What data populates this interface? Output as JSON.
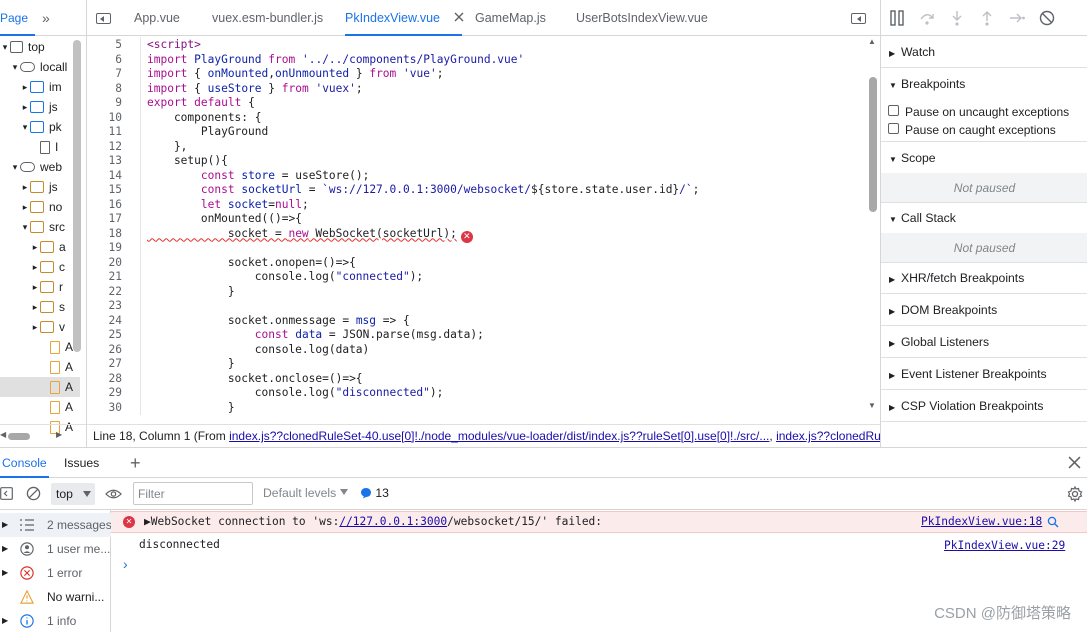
{
  "navigator": {
    "tab_page": "Page",
    "tab_more": "»",
    "items": [
      {
        "label": "top",
        "indent": 0,
        "arrow": "▾",
        "icon": "frame"
      },
      {
        "label": "locall",
        "indent": 1,
        "arrow": "▾",
        "icon": "cloud"
      },
      {
        "label": "im",
        "indent": 2,
        "arrow": "▸",
        "icon": "folder"
      },
      {
        "label": "js",
        "indent": 2,
        "arrow": "▸",
        "icon": "folder"
      },
      {
        "label": "pk",
        "indent": 2,
        "arrow": "▾",
        "icon": "folder"
      },
      {
        "label": "I",
        "indent": 3,
        "arrow": "",
        "icon": "file"
      },
      {
        "label": "web",
        "indent": 1,
        "arrow": "▾",
        "icon": "cloud"
      },
      {
        "label": "js",
        "indent": 2,
        "arrow": "▸",
        "icon": "folder-or"
      },
      {
        "label": "no",
        "indent": 2,
        "arrow": "▸",
        "icon": "folder-or"
      },
      {
        "label": "src",
        "indent": 2,
        "arrow": "▾",
        "icon": "folder-or"
      },
      {
        "label": "a",
        "indent": 3,
        "arrow": "▸",
        "icon": "folder-or"
      },
      {
        "label": "c",
        "indent": 3,
        "arrow": "▸",
        "icon": "folder-or"
      },
      {
        "label": "r",
        "indent": 3,
        "arrow": "▸",
        "icon": "folder-or"
      },
      {
        "label": "s",
        "indent": 3,
        "arrow": "▸",
        "icon": "folder-or"
      },
      {
        "label": "v",
        "indent": 3,
        "arrow": "▸",
        "icon": "folder-or"
      },
      {
        "label": "A",
        "indent": 4,
        "arrow": "",
        "icon": "file-or"
      },
      {
        "label": "A",
        "indent": 4,
        "arrow": "",
        "icon": "file-or"
      },
      {
        "label": "A",
        "indent": 4,
        "arrow": "",
        "icon": "file-or",
        "selected": true
      },
      {
        "label": "A",
        "indent": 4,
        "arrow": "",
        "icon": "file-or"
      },
      {
        "label": "A",
        "indent": 4,
        "arrow": "",
        "icon": "file-or"
      }
    ]
  },
  "editor": {
    "tabs": [
      {
        "label": "App.vue",
        "active": false
      },
      {
        "label": "vuex.esm-bundler.js",
        "active": false
      },
      {
        "label": "PkIndexView.vue",
        "active": true
      },
      {
        "label": "GameMap.js",
        "active": false
      },
      {
        "label": "UserBotsIndexView.vue",
        "active": false
      }
    ],
    "lines": [
      {
        "n": "5",
        "html": "<span class=\"tag\">&lt;script&gt;</span>"
      },
      {
        "n": "6",
        "html": "<span class=\"kw\">import</span> <span class=\"def\">PlayGround</span> <span class=\"kw\">from</span> <span class=\"str\">'../../components/PlayGround.vue'</span>"
      },
      {
        "n": "7",
        "html": "<span class=\"kw\">import</span> { <span class=\"def\">onMounted</span>,<span class=\"def\">onUnmounted</span> } <span class=\"kw\">from</span> <span class=\"str\">'vue'</span>;"
      },
      {
        "n": "8",
        "html": "<span class=\"kw\">import</span> { <span class=\"def\">useStore</span> } <span class=\"kw\">from</span> <span class=\"str\">'vuex'</span>;"
      },
      {
        "n": "9",
        "html": "<span class=\"kw\">export</span> <span class=\"kw\">default</span> {"
      },
      {
        "n": "10",
        "html": "    components: {"
      },
      {
        "n": "11",
        "html": "        PlayGround"
      },
      {
        "n": "12",
        "html": "    },"
      },
      {
        "n": "13",
        "html": "    setup(){"
      },
      {
        "n": "14",
        "html": "        <span class=\"kw\">const</span> <span class=\"def\">store</span> = useStore();"
      },
      {
        "n": "15",
        "html": "        <span class=\"kw\">const</span> <span class=\"def\">socketUrl</span> = <span class=\"str\">`ws://127.0.0.1:3000/websocket/</span>${store.state.user.id}<span class=\"str\">/`</span>;"
      },
      {
        "n": "16",
        "html": "        <span class=\"kw\">let</span> <span class=\"def\">socket</span>=<span class=\"kw\">null</span>;"
      },
      {
        "n": "17",
        "html": "        onMounted(()=>{"
      },
      {
        "n": "18",
        "html": "<span class=\"squig\">            socket = <span class=\"kw\">new</span> WebSocket(socketUrl);</span><span class=\"err-dot\">✕</span>"
      },
      {
        "n": "19",
        "html": ""
      },
      {
        "n": "20",
        "html": "            socket.onopen=()=>{"
      },
      {
        "n": "21",
        "html": "                console.log(<span class=\"str\">\"connected\"</span>);"
      },
      {
        "n": "22",
        "html": "            }"
      },
      {
        "n": "23",
        "html": ""
      },
      {
        "n": "24",
        "html": "            socket.onmessage = <span class=\"def\">msg</span> => {"
      },
      {
        "n": "25",
        "html": "                <span class=\"kw\">const</span> <span class=\"def\">data</span> = JSON.parse(msg.data);"
      },
      {
        "n": "26",
        "html": "                console.log(data)"
      },
      {
        "n": "27",
        "html": "            }"
      },
      {
        "n": "28",
        "html": "            socket.onclose=()=>{"
      },
      {
        "n": "29",
        "html": "                console.log(<span class=\"str\">\"disconnected\"</span>);"
      },
      {
        "n": "30",
        "html": "            }"
      }
    ],
    "status_prefix": "Line 18, Column 1  (From ",
    "status_link1": "index.js??clonedRuleSet-40.use[0]!./node_modules/vue-loader/dist/index.js??ruleSet[0].use[0]!./src/...",
    "status_sep": ", ",
    "status_link2": "index.js??clonedRuleS"
  },
  "debugger": {
    "watch": "Watch",
    "breakpoints": "Breakpoints",
    "pause_uncaught": "Pause on uncaught exceptions",
    "pause_caught": "Pause on caught exceptions",
    "scope": "Scope",
    "scope_empty": "Not paused",
    "call_stack": "Call Stack",
    "call_stack_empty": "Not paused",
    "xhr": "XHR/fetch Breakpoints",
    "dom": "DOM Breakpoints",
    "global": "Global Listeners",
    "event": "Event Listener Breakpoints",
    "csp": "CSP Violation Breakpoints"
  },
  "drawer": {
    "tab_console": "Console",
    "tab_issues": "Issues",
    "add_tab": "+",
    "context": "top",
    "filter_placeholder": "Filter",
    "levels": "Default levels",
    "issues_count": "13",
    "sidebar": [
      {
        "label": "2 messages",
        "icon": "list-icon"
      },
      {
        "label": "1 user me...",
        "icon": "user-icon"
      },
      {
        "label": "1 error",
        "icon": "error-icon"
      },
      {
        "label": "No warni...",
        "icon": "warning-icon"
      },
      {
        "label": "1 info",
        "icon": "info-icon"
      }
    ],
    "error_prefix": "▶WebSocket connection to 'ws:",
    "error_link": "//127.0.0.1:3000",
    "error_suffix": "/websocket/15/' failed:",
    "error_source": "PkIndexView.vue:18",
    "log_text": "disconnected",
    "log_source": "PkIndexView.vue:29",
    "prompt": "›"
  },
  "watermark": "CSDN @防御塔策略"
}
